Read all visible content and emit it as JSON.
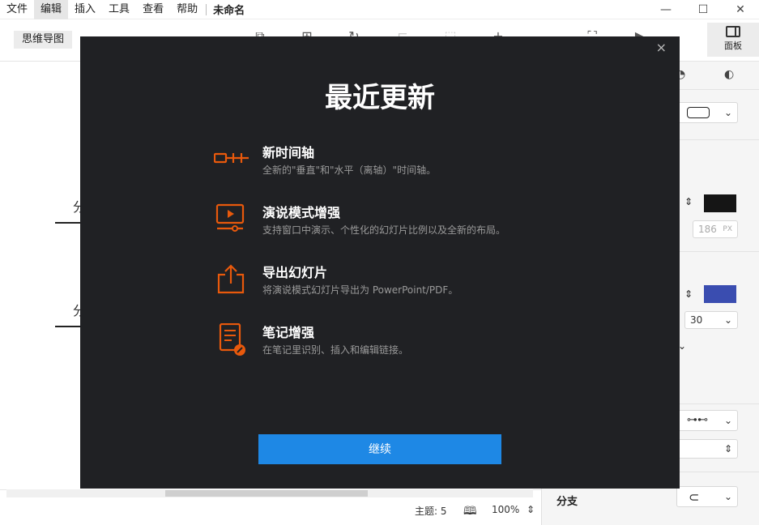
{
  "menu": {
    "items": [
      "文件",
      "编辑",
      "插入",
      "工具",
      "查看",
      "帮助"
    ],
    "active_index": 1,
    "document_title": "未命名"
  },
  "window": {
    "minimize": "—",
    "maximize": "☐",
    "close": "✕"
  },
  "toolbar": {
    "mode_label": "思维导图",
    "panel_label": "面板"
  },
  "canvas": {
    "branch_labels": [
      "分",
      "分"
    ]
  },
  "right_panel": {
    "width_value": "186",
    "width_unit": "PX",
    "size_value": "30",
    "branch_label": "分支"
  },
  "status": {
    "topics_label": "主题: 5",
    "zoom": "100%"
  },
  "dialog": {
    "title": "最近更新",
    "close": "×",
    "features": [
      {
        "icon": "timeline-icon",
        "title": "新时间轴",
        "desc": "全新的\"垂直\"和\"水平（离轴）\"时间轴。"
      },
      {
        "icon": "presentation-icon",
        "title": "演说模式增强",
        "desc": "支持窗口中演示、个性化的幻灯片比例以及全新的布局。"
      },
      {
        "icon": "export-icon",
        "title": "导出幻灯片",
        "desc": "将演说模式幻灯片导出为 PowerPoint/PDF。"
      },
      {
        "icon": "note-link-icon",
        "title": "笔记增强",
        "desc": "在笔记里识别、插入和编辑链接。"
      }
    ],
    "continue_label": "继续"
  },
  "colors": {
    "accent": "#e8590c",
    "button": "#1e88e5",
    "dialog_bg": "#202124",
    "swatch_dark": "#151515",
    "swatch_blue": "#3a4db0"
  }
}
